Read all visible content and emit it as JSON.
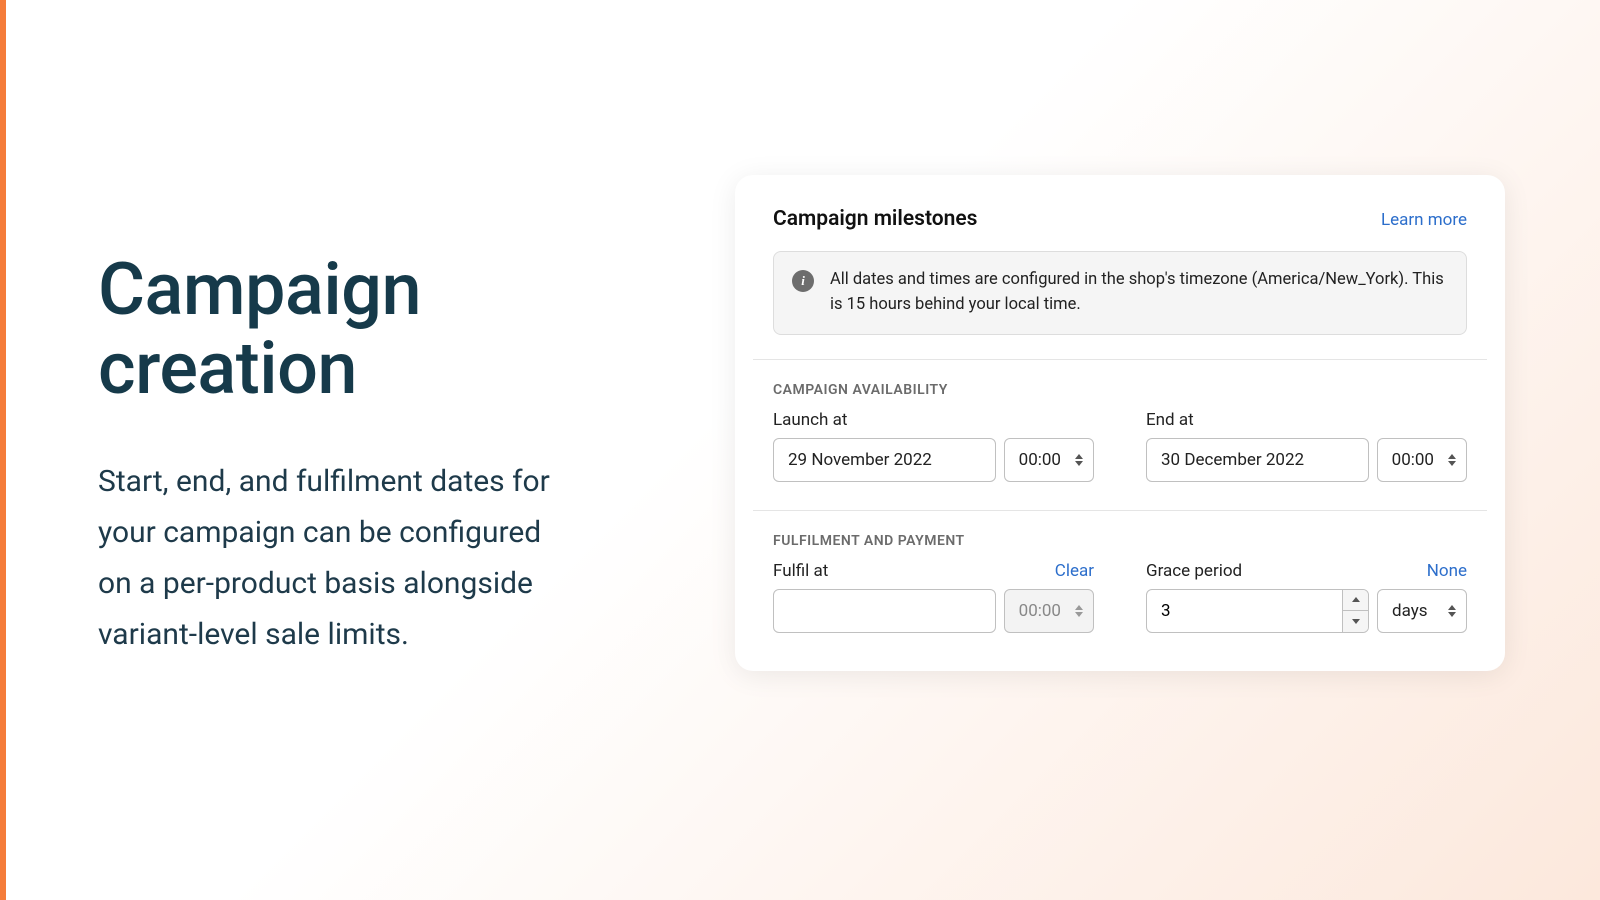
{
  "left": {
    "headline_l1": "Campaign",
    "headline_l2": "creation",
    "sub": "Start, end, and fulfilment dates for your campaign can be configured on a per-product basis alongside variant-level sale limits."
  },
  "card": {
    "title": "Campaign milestones",
    "learn": "Learn more",
    "banner": "All dates and times are configured in the shop's timezone (America/New_York). This is 15 hours behind your local time.",
    "availability": {
      "section": "CAMPAIGN AVAILABILITY",
      "launch_label": "Launch at",
      "launch_date": "29 November 2022",
      "launch_time": "00:00",
      "end_label": "End at",
      "end_date": "30 December 2022",
      "end_time": "00:00"
    },
    "fulfilment": {
      "section": "FULFILMENT AND PAYMENT",
      "fulfil_label": "Fulfil at",
      "clear": "Clear",
      "fulfil_date": "",
      "fulfil_time": "00:00",
      "grace_label": "Grace period",
      "none": "None",
      "grace_value": "3",
      "grace_unit": "days"
    }
  }
}
